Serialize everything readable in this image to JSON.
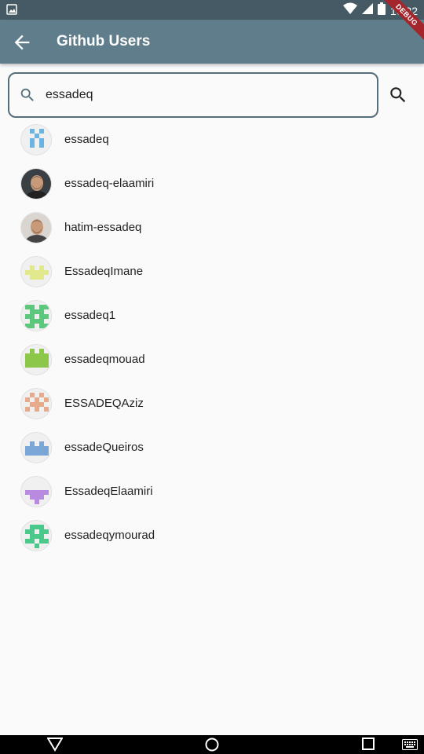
{
  "status_bar": {
    "time": "10:22",
    "icons": [
      "image-icon",
      "wifi-icon",
      "signal-icon",
      "battery-icon"
    ]
  },
  "debug_banner": "DEBUG",
  "app_bar": {
    "title": "Github Users",
    "back_icon": "arrow-back-icon"
  },
  "search": {
    "value": "essadeq",
    "prefix_icon": "search-icon",
    "button_icon": "search-icon"
  },
  "users": [
    {
      "login": "essadeq",
      "avatar": {
        "type": "identicon",
        "color": "#6bb3e0",
        "pattern": [
          "01010",
          "00100",
          "01010",
          "01010",
          "00000"
        ]
      }
    },
    {
      "login": "essadeq-elaamiri",
      "avatar": {
        "type": "photo",
        "color": "#3a3f44"
      }
    },
    {
      "login": "hatim-essadeq",
      "avatar": {
        "type": "photo",
        "color": "#d9d5d0"
      }
    },
    {
      "login": "EssadeqImane",
      "avatar": {
        "type": "identicon",
        "color": "#e2e98c",
        "pattern": [
          "00000",
          "01010",
          "11111",
          "01110",
          "00000"
        ]
      }
    },
    {
      "login": "essadeq1",
      "avatar": {
        "type": "identicon",
        "color": "#5ec77e",
        "pattern": [
          "11011",
          "01110",
          "11011",
          "01110",
          "11011"
        ]
      }
    },
    {
      "login": "essadeqmouad",
      "avatar": {
        "type": "identicon",
        "color": "#8cc74a",
        "pattern": [
          "01010",
          "11111",
          "11111",
          "11111",
          "00000"
        ]
      }
    },
    {
      "login": "ESSADEQAziz",
      "avatar": {
        "type": "identicon",
        "color": "#e6ab8c",
        "pattern": [
          "01010",
          "10101",
          "01110",
          "10101",
          "00000"
        ]
      }
    },
    {
      "login": "essadeQueiros",
      "avatar": {
        "type": "identicon",
        "color": "#7ba7d6",
        "pattern": [
          "00000",
          "01010",
          "11111",
          "11111",
          "00000"
        ]
      }
    },
    {
      "login": "EssadeqElaamiri",
      "avatar": {
        "type": "identicon",
        "color": "#b98be0",
        "pattern": [
          "00000",
          "00000",
          "11111",
          "01110",
          "00100"
        ]
      }
    },
    {
      "login": "essadeqymourad",
      "avatar": {
        "type": "identicon",
        "color": "#4bc98a",
        "pattern": [
          "01110",
          "11011",
          "01110",
          "11011",
          "00100"
        ]
      }
    }
  ],
  "nav_bar": {
    "icons": [
      "back-triangle-icon",
      "home-circle-icon",
      "recents-square-icon",
      "keyboard-icon"
    ]
  },
  "colors": {
    "app_bar": "#607d8b",
    "status_bar": "#455a64",
    "search_border": "#546e7a",
    "background": "#fafafa"
  }
}
